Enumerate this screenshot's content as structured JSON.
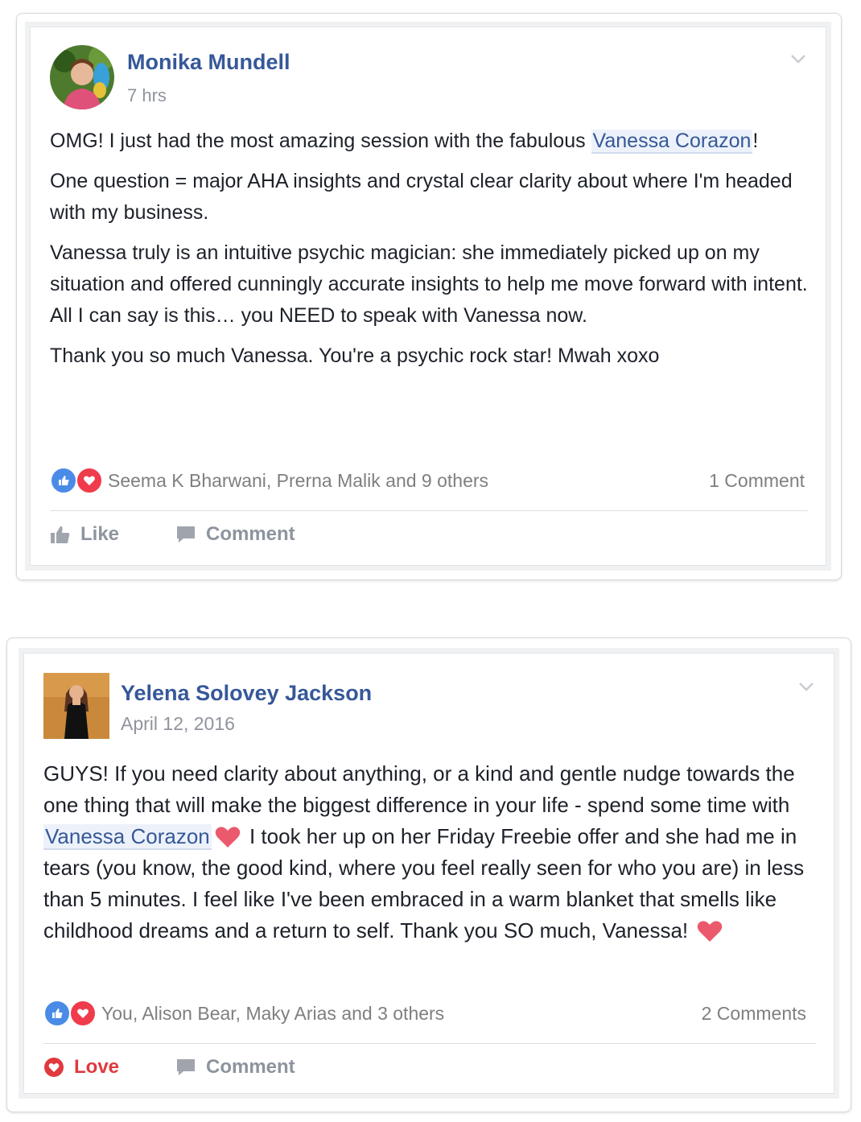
{
  "posts": [
    {
      "author": "Monika Mundell",
      "time": "7 hrs",
      "body": {
        "p1_text": "OMG! I just had the most amazing session with the fabulous ",
        "p1_mention": "Vanessa Corazon",
        "p1_end": "!",
        "p2": "One question = major AHA insights and crystal clear clarity about where I'm headed with my business.",
        "p3": "Vanessa truly is an intuitive psychic magician: she immediately picked up on my situation and offered cunningly accurate insights to help me move forward with intent. All I can say is this… you NEED to speak with Vanessa now.",
        "p4": "Thank you so much Vanessa. You're a psychic rock star! Mwah xoxo"
      },
      "reactions_text": "Seema K Bharwani, Prerna Malik and 9 others",
      "comments_count": "1 Comment",
      "actions": {
        "primary": "Like",
        "comment": "Comment"
      }
    },
    {
      "author": "Yelena Solovey Jackson",
      "time": "April 12, 2016",
      "body": {
        "part1": "GUYS! If you need clarity about anything, or a kind and gentle nudge towards the one thing that will make the biggest difference in your life - spend some time with ",
        "mention": "Vanessa Corazon",
        "part2": " I took her up on her Friday Freebie offer and she had me in tears (you know, the good kind, where you feel really seen for who you are) in less than 5 minutes. I feel like I've been embraced in a warm blanket that smells like childhood dreams and a return to self. Thank you SO much, Vanessa! "
      },
      "reactions_text": "You, Alison Bear, Maky Arias and 3 others",
      "comments_count": "2 Comments",
      "actions": {
        "primary": "Love",
        "comment": "Comment"
      }
    }
  ],
  "colors": {
    "author": "#365899",
    "meta": "#90949c",
    "like_blue": "#4a8be8",
    "love_red": "#ef3b4b",
    "action_gray": "#8d949e"
  }
}
